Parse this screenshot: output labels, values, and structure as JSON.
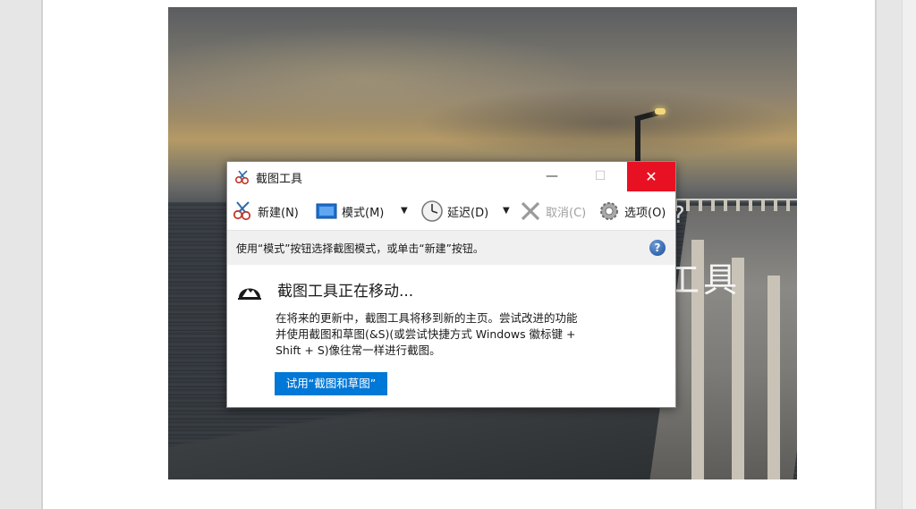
{
  "window": {
    "title": "截图工具",
    "minimize": "—",
    "maximize": "☐",
    "close": "✕"
  },
  "toolbar": {
    "new_label": "新建(N)",
    "mode_label": "模式(M)",
    "delay_label": "延迟(D)",
    "cancel_label": "取消(C)",
    "options_label": "选项(O)",
    "dropdown_arrow": "▼"
  },
  "hint": {
    "text": "使用“模式”按钮选择截图模式，或单击“新建”按钮。",
    "help": "?"
  },
  "notice": {
    "title": "截图工具正在移动...",
    "body_lines": [
      "在将来的更新中，截图工具将移到新的主页。尝试改进的功能",
      "并使用截图和草图(&S)(或尝试快捷方式 Windows 徽标键 +",
      "Shift + S)像往常一样进行截图。"
    ],
    "button_label": "试用“截图和草图”"
  },
  "background_overlay": {
    "char_text": "工具",
    "question_mark": "?"
  },
  "colors": {
    "close_red": "#e81123",
    "accent_blue": "#0078d7",
    "hint_bg": "#f0f0f0"
  },
  "icons": [
    "snipping-tool-icon",
    "mode-icon",
    "clock-icon",
    "cancel-x-icon",
    "gear-icon",
    "help-icon",
    "snip-sketch-icon"
  ]
}
